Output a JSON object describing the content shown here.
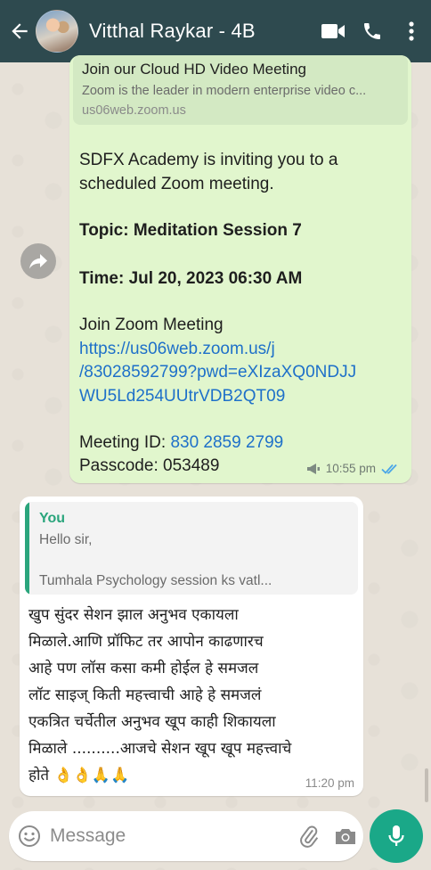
{
  "header": {
    "contact_name": "Vitthal Raykar - 4B",
    "icons": [
      "back-arrow-icon",
      "avatar",
      "video-call-icon",
      "phone-icon",
      "more-vert-icon"
    ],
    "bg_color": "#2e4a4f"
  },
  "outgoing": {
    "preview": {
      "title": "Join our Cloud HD Video Meeting",
      "description": "Zoom is the leader in modern enterprise video c...",
      "domain": "us06web.zoom.us"
    },
    "line1": "SDFX Academy is inviting you to a",
    "line2": "scheduled Zoom meeting.",
    "topic": "Topic:  Meditation Session 7",
    "time": "Time: Jul 20, 2023 06:30 AM",
    "join_label": "Join Zoom Meeting",
    "link_line1": "https://us06web.zoom.us/j",
    "link_line2": "/83028592799?pwd=eXIzaXQ0NDJJ",
    "link_line3": "WU5Ld254UUtrVDB2QT09",
    "meeting_id_label": "Meeting ID: ",
    "meeting_id": "830 2859 2799",
    "passcode": "Passcode: 053489",
    "timestamp": "10:55 pm",
    "status": "read-double-tick",
    "bg_color": "#e1f6cd"
  },
  "incoming": {
    "quote_author": "You",
    "quote_line1": "Hello sir,",
    "quote_line2": "Tumhala Psychology session ks vatl...",
    "text_lines": [
      "खुप सुंदर सेशन झाल अनुभव एकायला",
      "मिळाले.आणि प्रॉफिट तर आपोन काढणारच",
      "आहे पण लॉस कसा कमी होईल हे समजल",
      "लॉट साइज् किती महत्त्वाची आहे हे समजलं",
      "एकत्रित चर्चेतील अनुभव खूप काही शिकायला",
      "मिळाले ..........आजचे सेशन खूप खूप महत्त्वाचे",
      "होते 👌👌🙏🙏"
    ],
    "timestamp": "11:20 pm"
  },
  "composer": {
    "placeholder": "Message",
    "mic_color": "#1aa888"
  }
}
